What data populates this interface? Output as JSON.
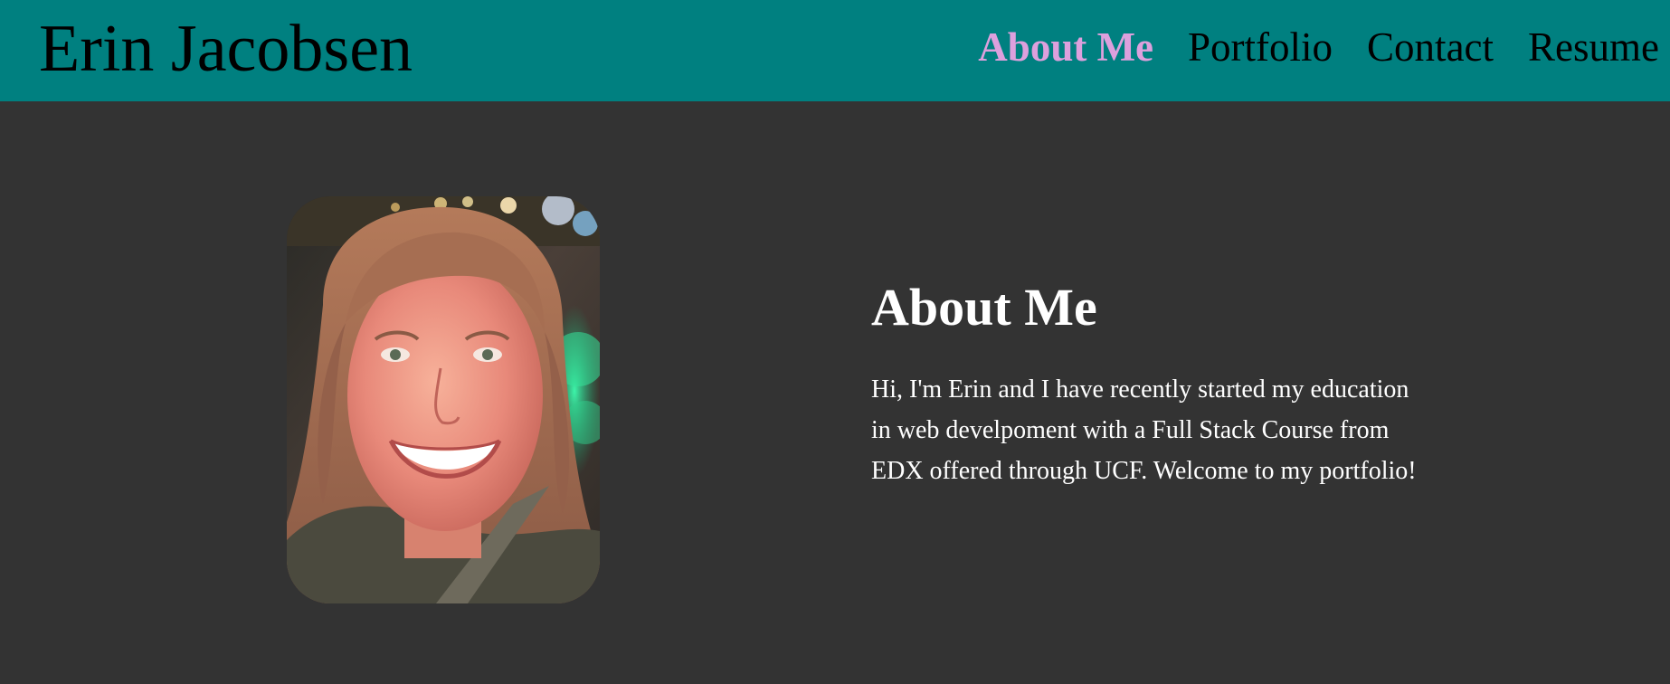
{
  "site": {
    "title": "Erin Jacobsen"
  },
  "nav": {
    "items": [
      {
        "label": "About Me",
        "active": true
      },
      {
        "label": "Portfolio",
        "active": false
      },
      {
        "label": "Contact",
        "active": false
      },
      {
        "label": "Resume",
        "active": false
      }
    ]
  },
  "about": {
    "heading": "About Me",
    "paragraph": "Hi, I'm Erin and I have recently started my education in web develpoment with a Full Stack Course from EDX offered through UCF. Welcome to my portfolio!"
  },
  "colors": {
    "header_bg": "#008080",
    "page_bg": "#333333",
    "active_link": "#dda0dd",
    "link": "#000000",
    "text": "#ffffff"
  },
  "icons": {
    "profile_photo": "portrait-photo"
  }
}
